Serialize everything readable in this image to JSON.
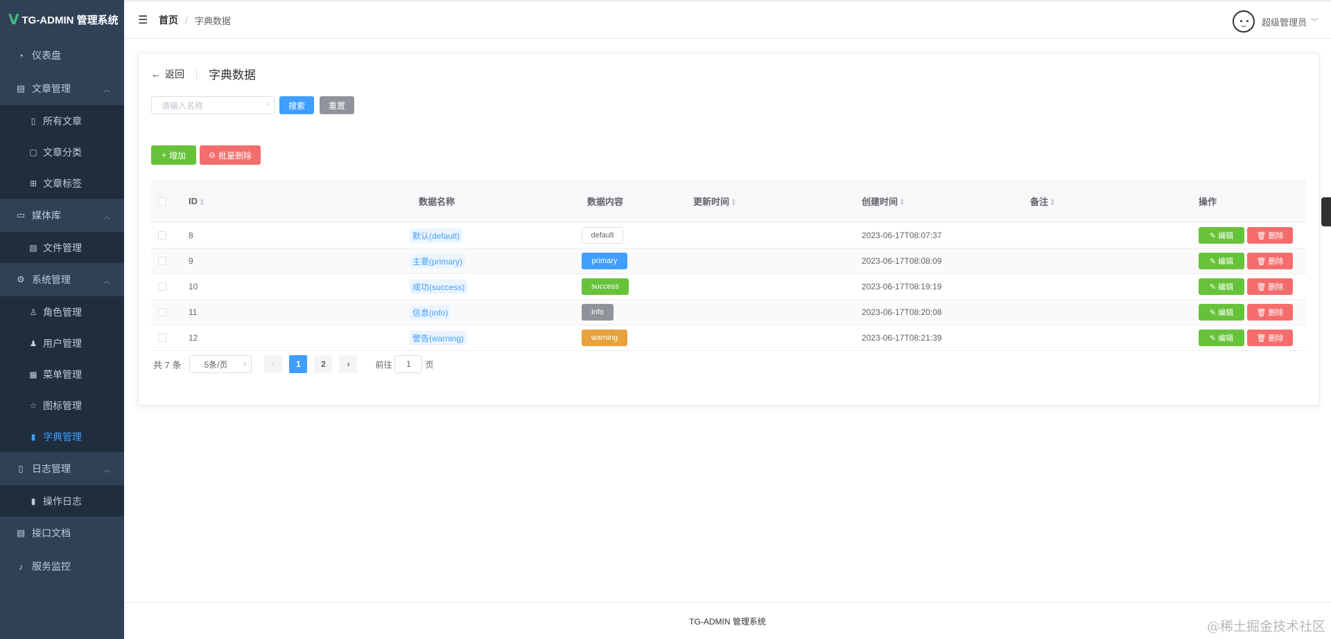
{
  "app": {
    "logo_mark": "V",
    "title": "TG-ADMIN 管理系统"
  },
  "sidebar": {
    "dashboard": "仪表盘",
    "article_mgmt": "文章管理",
    "all_articles": "所有文章",
    "article_category": "文章分类",
    "article_tags": "文章标签",
    "media": "媒体库",
    "file_mgmt": "文件管理",
    "system_mgmt": "系统管理",
    "role_mgmt": "角色管理",
    "user_mgmt": "用户管理",
    "menu_mgmt": "菜单管理",
    "icon_mgmt": "图标管理",
    "dict_mgmt": "字典管理",
    "log_mgmt": "日志管理",
    "op_log": "操作日志",
    "api_doc": "接口文档",
    "service_monitor": "服务监控"
  },
  "header": {
    "breadcrumb_home": "首页",
    "breadcrumb_sep": "/",
    "breadcrumb_current": "字典数据",
    "user_name": "超级管理员"
  },
  "page": {
    "back_label": "返回",
    "title": "字典数据",
    "search_placeholder": "请输入名称",
    "search_btn": "搜索",
    "reset_btn": "重置",
    "add_btn": "增加",
    "batch_delete_btn": "批量删除"
  },
  "table": {
    "headers": {
      "id": "ID",
      "name": "数据名称",
      "content": "数据内容",
      "updated": "更新时间",
      "created": "创建时间",
      "remark": "备注",
      "ops": "操作"
    },
    "edit_label": "编辑",
    "delete_label": "删除",
    "rows": [
      {
        "id": "8",
        "name": "默认(default)",
        "content": "default",
        "content_type": "default",
        "updated": "",
        "created": "2023-06-17T08:07:37",
        "remark": ""
      },
      {
        "id": "9",
        "name": "主要(primary)",
        "content": "primary",
        "content_type": "primary",
        "updated": "",
        "created": "2023-06-17T08:08:09",
        "remark": ""
      },
      {
        "id": "10",
        "name": "成功(success)",
        "content": "success",
        "content_type": "success",
        "updated": "",
        "created": "2023-06-17T08:19:19",
        "remark": ""
      },
      {
        "id": "11",
        "name": "信息(info)",
        "content": "info",
        "content_type": "info",
        "updated": "",
        "created": "2023-06-17T08:20:08",
        "remark": ""
      },
      {
        "id": "12",
        "name": "警告(warning)",
        "content": "warning",
        "content_type": "warning",
        "updated": "",
        "created": "2023-06-17T08:21:39",
        "remark": ""
      }
    ]
  },
  "pagination": {
    "total_text": "共 7 条",
    "page_size": "5条/页",
    "pages": [
      "1",
      "2"
    ],
    "current_page": "1",
    "goto_prefix": "前往",
    "goto_value": "1",
    "goto_suffix": "页"
  },
  "footer": {
    "text": "TG-ADMIN 管理系统"
  },
  "watermark": "@稀土掘金技术社区",
  "colors": {
    "sidebar_bg": "#304156",
    "primary": "#409eff",
    "success": "#67c23a",
    "danger": "#f56c6c",
    "warning": "#e6a23c",
    "info": "#909399"
  }
}
